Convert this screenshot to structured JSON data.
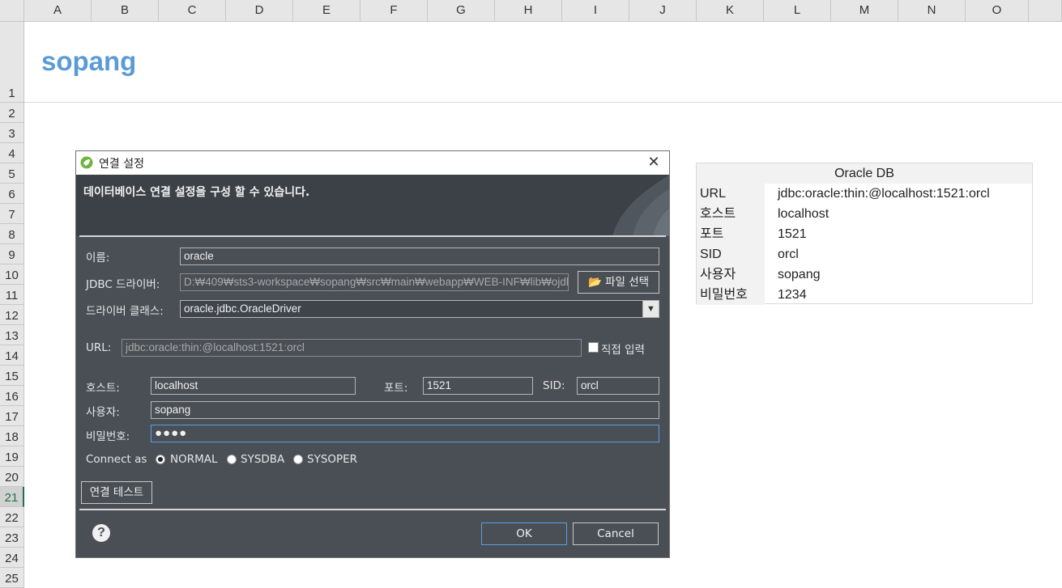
{
  "sheet": {
    "columns": [
      "A",
      "B",
      "C",
      "D",
      "E",
      "F",
      "G",
      "H",
      "I",
      "J",
      "K",
      "L",
      "M",
      "N",
      "O"
    ],
    "rows": [
      "1",
      "2",
      "3",
      "4",
      "5",
      "6",
      "7",
      "8",
      "9",
      "10",
      "11",
      "12",
      "13",
      "14",
      "15",
      "16",
      "17",
      "18",
      "19",
      "20",
      "21",
      "22",
      "23",
      "24",
      "25"
    ],
    "active_row": "21",
    "title": "sopang"
  },
  "db_table": {
    "header": "Oracle DB",
    "rows": [
      {
        "key": "URL",
        "value": "jdbc:oracle:thin:@localhost:1521:orcl"
      },
      {
        "key": "호스트",
        "value": "localhost"
      },
      {
        "key": "포트",
        "value": "1521"
      },
      {
        "key": "SID",
        "value": "orcl"
      },
      {
        "key": "사용자",
        "value": "sopang"
      },
      {
        "key": "비밀번호",
        "value": "1234"
      }
    ]
  },
  "dialog": {
    "title": "연결 설정",
    "banner": "데이터베이스 연결 설정을 구성 할 수 있습니다.",
    "name_label": "이름:",
    "name_value": "oracle",
    "driver_label": "JDBC 드라이버:",
    "driver_value": "D:₩409₩sts3-workspace₩sopang₩src₩main₩webapp₩WEB-INF₩lib₩ojdbc",
    "file_button": "파일 선택",
    "class_label": "드라이버 클래스:",
    "class_value": "oracle.jdbc.OracleDriver",
    "url_label": "URL:",
    "url_value": "jdbc:oracle:thin:@localhost:1521:orcl",
    "direct_input": "직접 입력",
    "host_label": "호스트:",
    "host_value": "localhost",
    "port_label": "포트:",
    "port_value": "1521",
    "sid_label": "SID:",
    "sid_value": "orcl",
    "user_label": "사용자:",
    "user_value": "sopang",
    "password_label": "비밀번호:",
    "password_value": "●●●●",
    "connect_as_label": "Connect as",
    "connect_as_options": [
      "NORMAL",
      "SYSDBA",
      "SYSOPER"
    ],
    "connect_as_selected": "NORMAL",
    "test_button": "연결 테스트",
    "ok_button": "OK",
    "cancel_button": "Cancel"
  }
}
